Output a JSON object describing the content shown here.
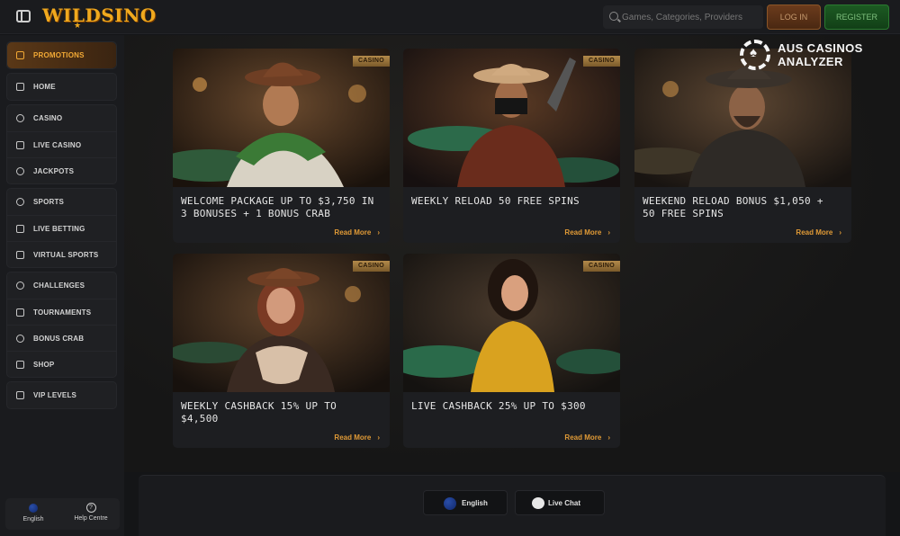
{
  "header": {
    "logo": "WILDSINO",
    "search_placeholder": "Games, Categories, Providers",
    "login_label": "LOG IN",
    "register_label": "REGISTER"
  },
  "sidebar": {
    "groups": [
      [
        {
          "label": "PROMOTIONS",
          "icon": "gift-icon",
          "active": true
        }
      ],
      [
        {
          "label": "HOME",
          "icon": "home-icon"
        }
      ],
      [
        {
          "label": "CASINO",
          "icon": "chip-icon"
        },
        {
          "label": "LIVE CASINO",
          "icon": "spade-icon"
        },
        {
          "label": "JACKPOTS",
          "icon": "jackpot-icon"
        }
      ],
      [
        {
          "label": "SPORTS",
          "icon": "ball-icon"
        },
        {
          "label": "LIVE BETTING",
          "icon": "play-icon"
        },
        {
          "label": "VIRTUAL SPORTS",
          "icon": "gamepad-icon"
        }
      ],
      [
        {
          "label": "CHALLENGES",
          "icon": "target-icon"
        },
        {
          "label": "TOURNAMENTS",
          "icon": "trophy-icon"
        },
        {
          "label": "BONUS CRAB",
          "icon": "leaf-icon"
        },
        {
          "label": "SHOP",
          "icon": "shop-icon"
        }
      ],
      [
        {
          "label": "VIP LEVELS",
          "icon": "vip-icon"
        }
      ]
    ],
    "footer": {
      "language": "English",
      "help": "Help Centre"
    }
  },
  "promotions": [
    {
      "badge": "CASINO",
      "title": "WELCOME PACKAGE UP TO $3,750 IN 3 BONUSES + 1 BONUS CRAB",
      "more": "Read More"
    },
    {
      "badge": "CASINO",
      "title": "WEEKLY RELOAD 50 FREE SPINS",
      "more": "Read More"
    },
    {
      "badge": "CASINO",
      "title": "WEEKEND RELOAD BONUS $1,050 + 50 FREE SPINS",
      "more": "Read More"
    },
    {
      "badge": "CASINO",
      "title": "WEEKLY CASHBACK 15% UP TO $4,500",
      "more": "Read More"
    },
    {
      "badge": "CASINO",
      "title": "LIVE CASHBACK 25% UP TO $300",
      "more": "Read More"
    }
  ],
  "footer": {
    "language": "English",
    "chat": "Live Chat"
  },
  "watermark": {
    "line1": "AUS CASINOS",
    "line2": "ANALYZER"
  },
  "colors": {
    "accent": "#f2a935",
    "register": "#1c5a22",
    "login": "#6b3b1c"
  }
}
